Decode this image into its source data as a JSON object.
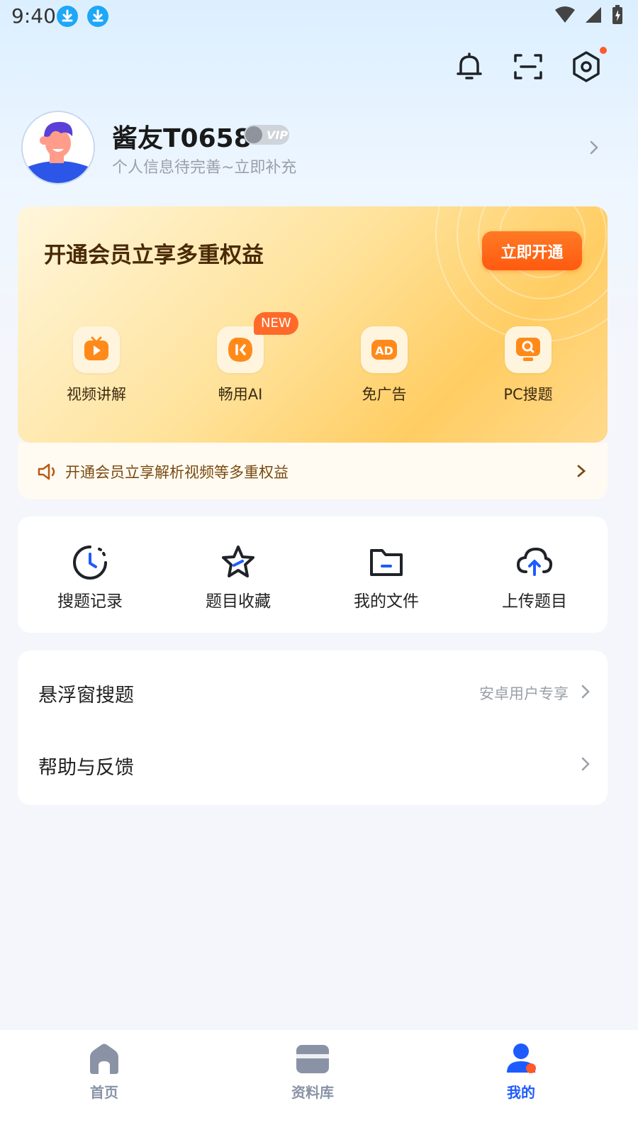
{
  "status": {
    "time": "9:40"
  },
  "profile": {
    "name": "酱友T0658",
    "vip_badge": "VIP",
    "subtitle": "个人信息待完善~立即补充"
  },
  "vip_card": {
    "title": "开通会员立享多重权益",
    "cta": "立即开通",
    "benefits": [
      {
        "label": "视频讲解",
        "icon": "video-play-icon"
      },
      {
        "label": "畅用AI",
        "icon": "ai-chat-icon",
        "tag": "NEW"
      },
      {
        "label": "免广告",
        "icon": "ad-icon"
      },
      {
        "label": "PC搜题",
        "icon": "pc-search-icon"
      }
    ],
    "promo": "开通会员立享解析视频等多重权益"
  },
  "tools": [
    {
      "label": "搜题记录",
      "icon": "history-clock-icon"
    },
    {
      "label": "题目收藏",
      "icon": "star-icon"
    },
    {
      "label": "我的文件",
      "icon": "folder-icon"
    },
    {
      "label": "上传题目",
      "icon": "cloud-upload-icon"
    }
  ],
  "list": [
    {
      "label": "悬浮窗搜题",
      "hint": "安卓用户专享"
    },
    {
      "label": "帮助与反馈",
      "hint": ""
    }
  ],
  "nav": [
    {
      "label": "首页",
      "icon": "home-icon",
      "active": false
    },
    {
      "label": "资料库",
      "icon": "library-icon",
      "active": false
    },
    {
      "label": "我的",
      "icon": "profile-icon",
      "active": true
    }
  ],
  "colors": {
    "accent": "#1e5bff",
    "vip_orange": "#ff5a10",
    "nav_inactive": "#8a93a6"
  }
}
